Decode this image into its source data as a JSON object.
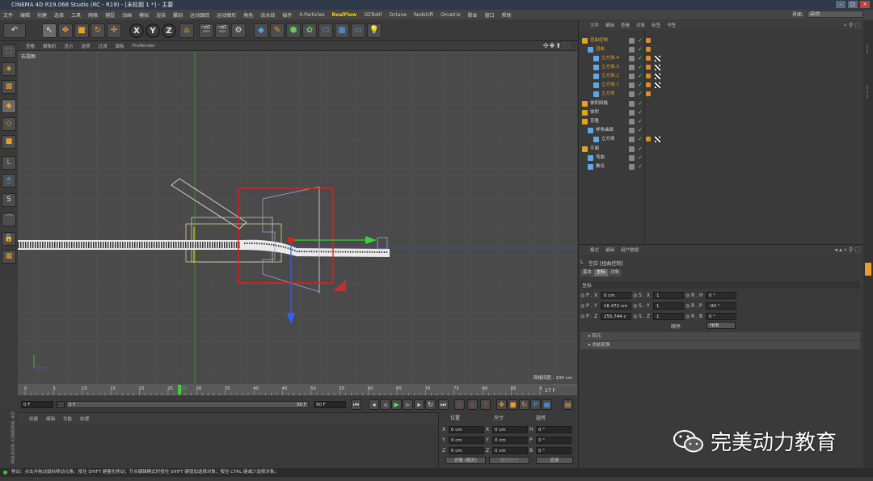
{
  "window": {
    "title": "CINEMA 4D R19.068 Studio (RC - R19) - [未标题 1 *] - 主要"
  },
  "menubar": {
    "items": [
      "文件",
      "编辑",
      "创建",
      "选择",
      "工具",
      "网格",
      "捕捉",
      "动画",
      "模拟",
      "渲染",
      "雕刻",
      "运动跟踪",
      "运动图形",
      "角色",
      "流水线",
      "插件",
      "X-Particles",
      "RealFlow",
      "3DToAll",
      "Octane",
      "Redshift",
      "Omatrix",
      "脚本",
      "窗口",
      "帮助"
    ],
    "layout_label": "界面:",
    "layout_value": "启动"
  },
  "viewport": {
    "menu": [
      "查看",
      "摄像机",
      "显示",
      "选项",
      "过滤",
      "面板",
      "ProRender"
    ],
    "label": "右视图",
    "grid_spacing": "网格间距 : 100 cm"
  },
  "timeline": {
    "ticks": [
      "0",
      "5",
      "10",
      "15",
      "20",
      "25",
      "27",
      "30",
      "35",
      "40",
      "45",
      "50",
      "55",
      "60",
      "65",
      "70",
      "75",
      "80",
      "85",
      "90"
    ],
    "current_frame": 27,
    "end_display": "27 F"
  },
  "transport": {
    "start": "0 F",
    "min": "0 F",
    "max": "90 F",
    "end": "90 F"
  },
  "material_manager": {
    "menu": [
      "创建",
      "编辑",
      "功能",
      "纹理"
    ]
  },
  "coord_manager": {
    "headers": [
      "位置",
      "尺寸",
      "旋转"
    ],
    "rows": [
      {
        "l1": "X",
        "v1": "0 cm",
        "l2": "X",
        "v2": "0 cm",
        "l3": "H",
        "v3": "0 °"
      },
      {
        "l1": "Y",
        "v1": "0 cm",
        "l2": "Y",
        "v2": "0 cm",
        "l3": "P",
        "v3": "0 °"
      },
      {
        "l1": "Z",
        "v1": "0 cm",
        "l2": "Z",
        "v2": "0 cm",
        "l3": "B",
        "v3": "0 °"
      }
    ],
    "mode": "对象 (相对)",
    "size_mode": "绝对尺寸",
    "apply": "应用"
  },
  "object_manager": {
    "menu": [
      "文件",
      "编辑",
      "查看",
      "对象",
      "标签",
      "书签"
    ],
    "rows": [
      {
        "name": "扭曲控制",
        "indent": 0,
        "orange": true
      },
      {
        "name": "扭曲",
        "indent": 1,
        "orange": true
      },
      {
        "name": "立方体.4",
        "indent": 2,
        "orange": true
      },
      {
        "name": "立方体.3",
        "indent": 2,
        "orange": true
      },
      {
        "name": "立方体.2",
        "indent": 2,
        "orange": true
      },
      {
        "name": "立方体.1",
        "indent": 2,
        "orange": true
      },
      {
        "name": "立方体",
        "indent": 2,
        "orange": true
      },
      {
        "name": "体积网格",
        "indent": 0,
        "orange": false
      },
      {
        "name": "体积",
        "indent": 0,
        "orange": false
      },
      {
        "name": "克隆",
        "indent": 0,
        "orange": false
      },
      {
        "name": "样条曲面",
        "indent": 1,
        "orange": false
      },
      {
        "name": "立方体",
        "indent": 2,
        "orange": false
      },
      {
        "name": "平面",
        "indent": 0,
        "orange": false
      },
      {
        "name": "弯曲",
        "indent": 1,
        "orange": false
      },
      {
        "name": "推论",
        "indent": 1,
        "orange": false
      }
    ]
  },
  "attribute_manager": {
    "menu": [
      "模式",
      "编辑",
      "用户数据"
    ],
    "object_title": "空白 [扭曲控制]",
    "tabs": [
      "基本",
      "坐标",
      "对象"
    ],
    "section": "坐标",
    "pos": [
      {
        "axis": "X",
        "value": "0 cm"
      },
      {
        "axis": "Y",
        "value": "16.472 cm"
      },
      {
        "axis": "Z",
        "value": "255.744 c"
      }
    ],
    "scale": [
      {
        "axis": "X",
        "value": "1"
      },
      {
        "axis": "Y",
        "value": "1"
      },
      {
        "axis": "Z",
        "value": "1"
      }
    ],
    "rot": [
      {
        "axis": "H",
        "value": "0 °"
      },
      {
        "axis": "P",
        "value": "-90 °"
      },
      {
        "axis": "B",
        "value": "0 °"
      }
    ],
    "order_label": "顺序",
    "order_value": "HPB",
    "collapsed": [
      "四元",
      "冻结变换"
    ]
  },
  "status": {
    "text": "移动：点击并拖动鼠标移动元素。按住 SHIFT 键量化移动；节点编辑模式时按住 SHIFT 键增加选择对象；按住 CTRL 键减少选择对象。"
  },
  "watermark": {
    "text": "完美动力教育"
  },
  "colors": {
    "accent_yellow": "#ffd400",
    "selection_red": "#e02020",
    "axis_green": "#3fcf3f",
    "axis_blue": "#3060ff",
    "orange": "#e0a030"
  }
}
